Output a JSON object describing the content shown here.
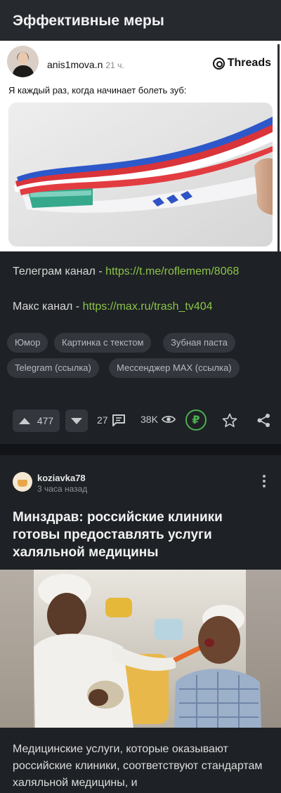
{
  "post1": {
    "title": "Эффективные меры",
    "threads": {
      "username": "anis1mova.n",
      "time": "21 ч.",
      "brand": "Threads",
      "text": "Я каждый раз, когда начинает болеть зуб:"
    },
    "links": [
      {
        "label": "Телеграм канал - ",
        "url": "https://t.me/roflemem/8068"
      },
      {
        "label": "Макс канал - ",
        "url": "https://max.ru/trash_tv404"
      }
    ],
    "tags": [
      "Юмор",
      "Картинка с текстом",
      "Зубная паста",
      "Telegram (ссылка)",
      "Мессенджер MAX (ссылка)"
    ],
    "rating": "477",
    "comments": "27",
    "views": "38K",
    "donate_symbol": "₽"
  },
  "post2": {
    "author": "koziavka78",
    "time": "3 часа назад",
    "title": "Минздрав: российские клиники готовы предоставлять услуги халяльной медицины",
    "text": "Медицинские услуги, которые оказывают российские клиники, соответствуют стандартам халяльной медицины, и"
  },
  "colors": {
    "background": "#1e2125",
    "link": "#8bc34a",
    "chip": "#33373d",
    "donate": "#4caf50"
  },
  "icons": [
    "threads-logo-icon",
    "arrow-up-icon",
    "arrow-down-icon",
    "comment-icon",
    "eye-icon",
    "ruble-icon",
    "star-icon",
    "share-icon",
    "more-vertical-icon"
  ]
}
